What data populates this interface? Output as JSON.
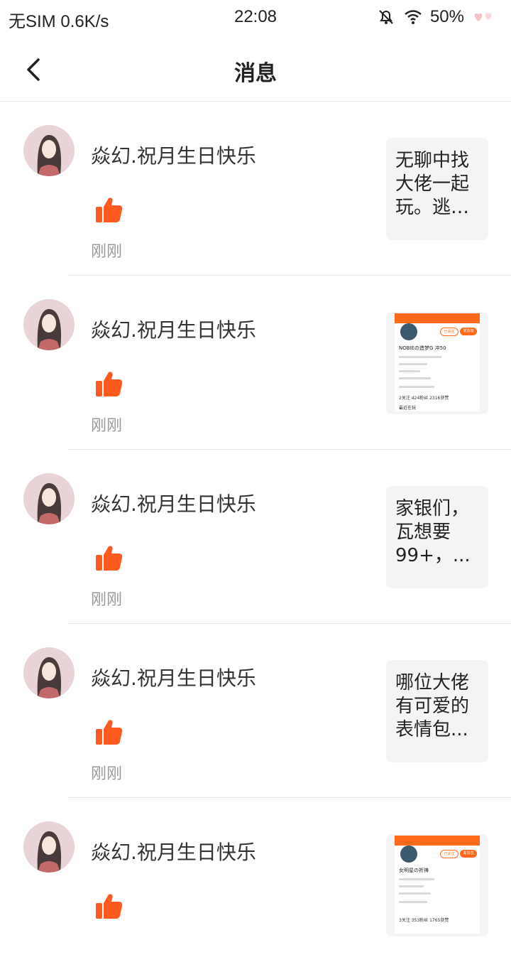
{
  "status_bar": {
    "carrier": "无SIM",
    "speed": "0.6K/s",
    "time": "22:08",
    "battery": "50%"
  },
  "header": {
    "back_icon": "chevron-left-icon",
    "title": "消息"
  },
  "colors": {
    "accent": "#ff5a1f",
    "preview_bg": "#f4f4f4",
    "divider": "#e6e6e6",
    "time_text": "#9a9a9a"
  },
  "messages": [
    {
      "name": "焱幻.祝月生日快乐",
      "action_icon": "thumbs-up-icon",
      "time": "刚刚",
      "preview_type": "text",
      "preview_text": "无聊中找大佬一起玩。逃跑..."
    },
    {
      "name": "焱幻.祝月生日快乐",
      "action_icon": "thumbs-up-icon",
      "time": "刚刚",
      "preview_type": "image",
      "preview_image": {
        "follow": "已关注",
        "message": "发消息",
        "title": "NOBIEの造梦G 冲50",
        "stats": "2关注 424粉丝 2316获赞",
        "tab": "最近在玩"
      }
    },
    {
      "name": "焱幻.祝月生日快乐",
      "action_icon": "thumbs-up-icon",
      "time": "刚刚",
      "preview_type": "text",
      "preview_text": "家银们，瓦想要99+，..."
    },
    {
      "name": "焱幻.祝月生日快乐",
      "action_icon": "thumbs-up-icon",
      "time": "刚刚",
      "preview_type": "text",
      "preview_text": "哪位大佬有可爱的表情包..."
    },
    {
      "name": "焱幻.祝月生日快乐",
      "action_icon": "thumbs-up-icon",
      "time": "",
      "preview_type": "image",
      "preview_image": {
        "follow": "已关注",
        "message": "发消息",
        "title": "女明星の祈祷",
        "stats": "3关注 353粉丝 1765获赞",
        "tab": ""
      }
    }
  ]
}
